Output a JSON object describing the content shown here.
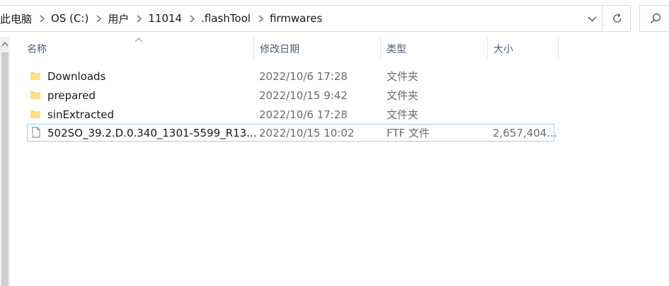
{
  "breadcrumb": [
    "此电脑",
    "OS (C:)",
    "用户",
    "11014",
    ".flashTool",
    "firmwares"
  ],
  "columns": [
    "名称",
    "修改日期",
    "类型",
    "大小"
  ],
  "rows": [
    {
      "name": "Downloads",
      "date": "2022/10/6 17:28",
      "type": "文件夹",
      "size": "",
      "icon": "folder-icon"
    },
    {
      "name": "prepared",
      "date": "2022/10/15 9:42",
      "type": "文件夹",
      "size": "",
      "icon": "folder-icon"
    },
    {
      "name": "sinExtracted",
      "date": "2022/10/6 17:28",
      "type": "文件夹",
      "size": "",
      "icon": "folder-icon"
    },
    {
      "name": "502SO_39.2.D.0.340_1301-5599_R13...",
      "date": "2022/10/15 10:02",
      "type": "FTF 文件",
      "size": "2,657,404...",
      "icon": "file-icon"
    }
  ],
  "colors": {
    "folder": "#f8d775",
    "header_text": "#4c607a",
    "selection_border": "#99d1ff"
  }
}
